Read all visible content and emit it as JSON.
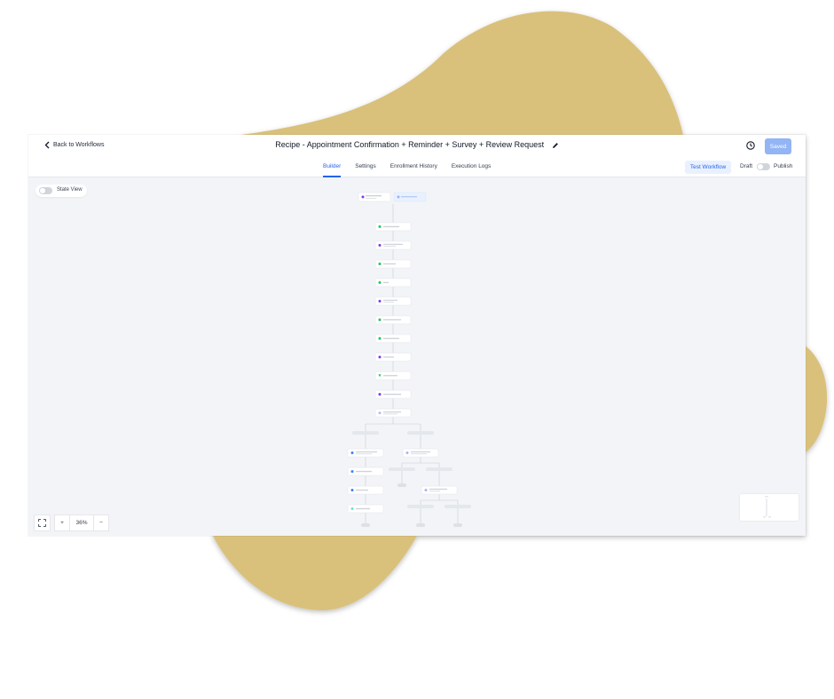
{
  "header": {
    "back_label": "Back to Workflows",
    "title": "Recipe - Appointment Confirmation + Reminder + Survey + Review Request",
    "saved_label": "Saved"
  },
  "tabs": [
    {
      "label": "Builder",
      "active": true
    },
    {
      "label": "Settings",
      "active": false
    },
    {
      "label": "Enrollment History",
      "active": false
    },
    {
      "label": "Execution Logs",
      "active": false
    }
  ],
  "actions": {
    "test_label": "Test Workflow",
    "draft_label": "Draft",
    "publish_label": "Publish",
    "publish_enabled": false
  },
  "canvas": {
    "state_view_label": "State View",
    "state_view_enabled": false,
    "zoom_level": "36%",
    "zoom_in": "+",
    "zoom_out": "−"
  },
  "colors": {
    "accent": "#2563eb",
    "saved_button": "#93b4f5",
    "blob": "#d9c17b",
    "canvas_bg": "#f2f4f7",
    "step_green": "#22c55e",
    "step_purple": "#7c3aed",
    "step_blue": "#3b82f6"
  }
}
